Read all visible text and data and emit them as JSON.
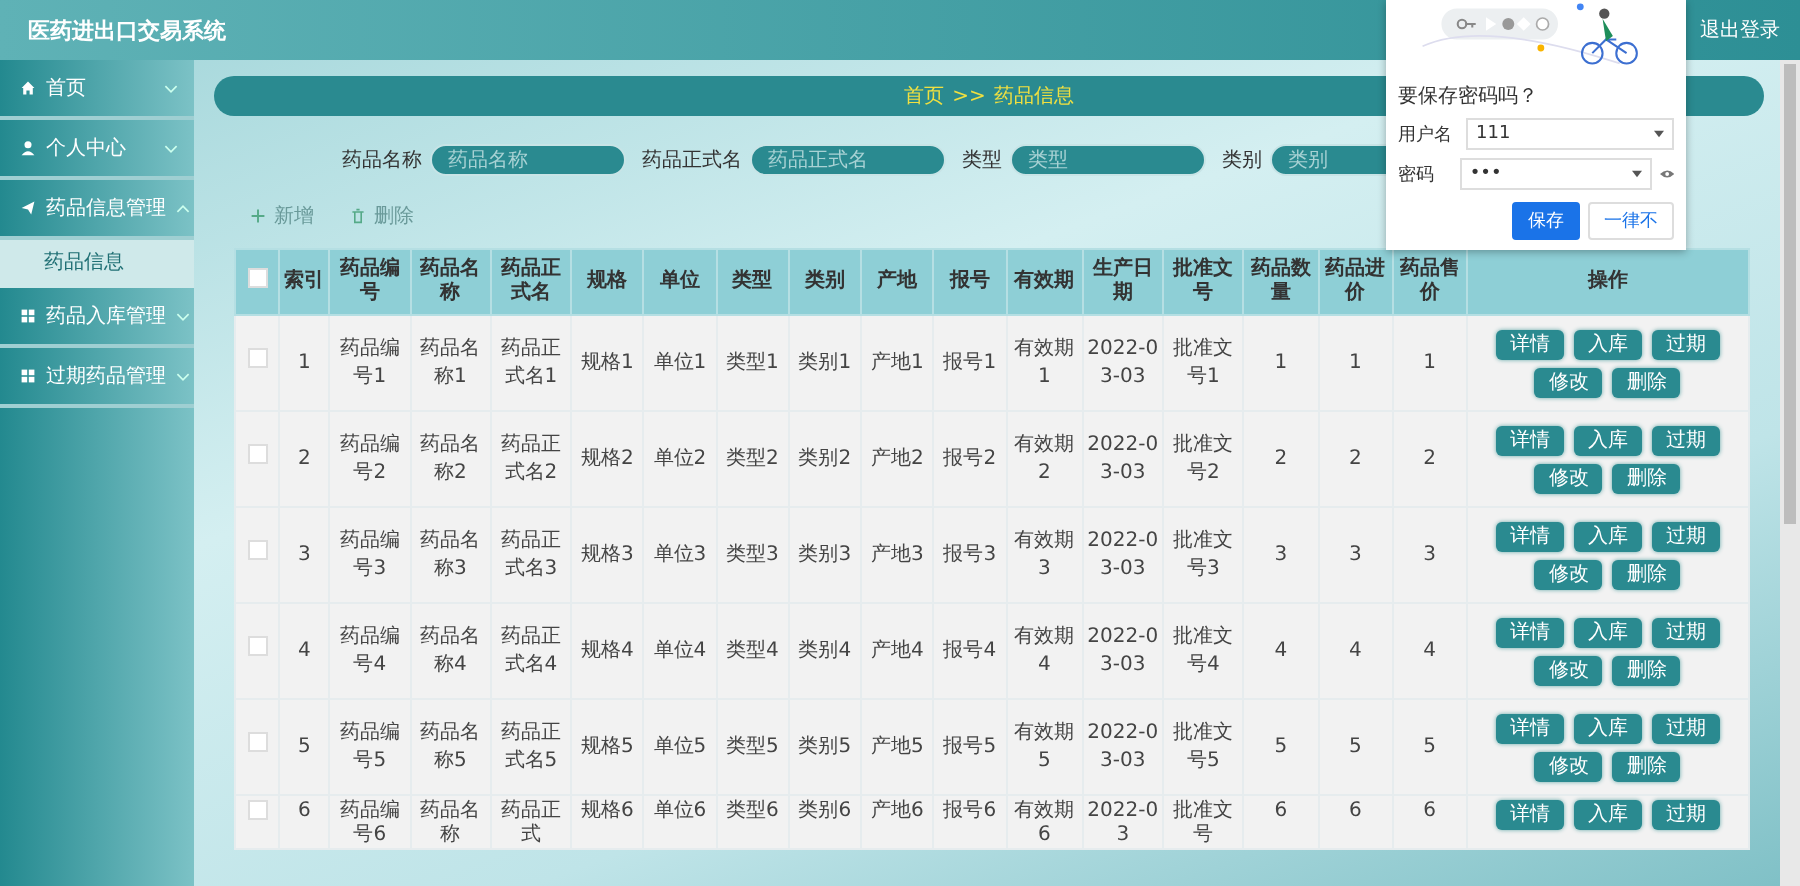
{
  "header": {
    "title": "医药进出口交易系统",
    "logout": "退出登录"
  },
  "sidebar": {
    "items": [
      {
        "label": "首页",
        "expanded": false
      },
      {
        "label": "个人中心",
        "expanded": false
      },
      {
        "label": "药品信息管理",
        "expanded": true,
        "children": [
          {
            "label": "药品信息",
            "selected": true
          }
        ]
      },
      {
        "label": "药品入库管理",
        "expanded": false
      },
      {
        "label": "过期药品管理",
        "expanded": false
      }
    ]
  },
  "breadcrumb": [
    "首页",
    ">>",
    "药品信息"
  ],
  "search": [
    {
      "label": "药品名称",
      "placeholder": "药品名称"
    },
    {
      "label": "药品正式名",
      "placeholder": "药品正式名"
    },
    {
      "label": "类型",
      "placeholder": "类型"
    },
    {
      "label": "类别",
      "placeholder": "类别"
    }
  ],
  "toolbar": [
    {
      "kind": "add",
      "label": "新增"
    },
    {
      "kind": "delete",
      "label": "删除"
    }
  ],
  "table": {
    "header_checked": false,
    "columns": [
      "索引",
      "药品编号",
      "药品名称",
      "药品正式名",
      "规格",
      "单位",
      "类型",
      "类别",
      "产地",
      "报号",
      "有效期",
      "生产日期",
      "批准文号",
      "药品数量",
      "药品进价",
      "药品售价",
      "操作"
    ],
    "rows": [
      {
        "checked": false,
        "cells": [
          "1",
          "药品编号1",
          "药品名称1",
          "药品正式名1",
          "规格1",
          "单位1",
          "类型1",
          "类别1",
          "产地1",
          "报号1",
          "有效期1",
          "2022-03-03",
          "批准文号1",
          "1",
          "1",
          "1"
        ],
        "actions": [
          "详情",
          "入库",
          "过期",
          "修改",
          "删除"
        ]
      },
      {
        "checked": false,
        "cells": [
          "2",
          "药品编号2",
          "药品名称2",
          "药品正式名2",
          "规格2",
          "单位2",
          "类型2",
          "类别2",
          "产地2",
          "报号2",
          "有效期2",
          "2022-03-03",
          "批准文号2",
          "2",
          "2",
          "2"
        ],
        "actions": [
          "详情",
          "入库",
          "过期",
          "修改",
          "删除"
        ]
      },
      {
        "checked": false,
        "cells": [
          "3",
          "药品编号3",
          "药品名称3",
          "药品正式名3",
          "规格3",
          "单位3",
          "类型3",
          "类别3",
          "产地3",
          "报号3",
          "有效期3",
          "2022-03-03",
          "批准文号3",
          "3",
          "3",
          "3"
        ],
        "actions": [
          "详情",
          "入库",
          "过期",
          "修改",
          "删除"
        ]
      },
      {
        "checked": false,
        "cells": [
          "4",
          "药品编号4",
          "药品名称4",
          "药品正式名4",
          "规格4",
          "单位4",
          "类型4",
          "类别4",
          "产地4",
          "报号4",
          "有效期4",
          "2022-03-03",
          "批准文号4",
          "4",
          "4",
          "4"
        ],
        "actions": [
          "详情",
          "入库",
          "过期",
          "修改",
          "删除"
        ]
      },
      {
        "checked": false,
        "cells": [
          "5",
          "药品编号5",
          "药品名称5",
          "药品正式名5",
          "规格5",
          "单位5",
          "类型5",
          "类别5",
          "产地5",
          "报号5",
          "有效期5",
          "2022-03-03",
          "批准文号5",
          "5",
          "5",
          "5"
        ],
        "actions": [
          "详情",
          "入库",
          "过期",
          "修改",
          "删除"
        ]
      },
      {
        "checked": false,
        "cells": [
          "6",
          "药品编号6",
          "药品名称",
          "药品正式",
          "规格6",
          "单位6",
          "类型6",
          "类别6",
          "产地6",
          "报号6",
          "有效期6",
          "2022-03",
          "批准文号",
          "6",
          "6",
          "6"
        ],
        "actions": [
          "详情",
          "入库",
          "过期"
        ]
      }
    ]
  },
  "password_popup": {
    "title": "要保存密码吗？",
    "fields": [
      {
        "label": "用户名",
        "value": "111",
        "secret": false
      },
      {
        "label": "密码",
        "value": "•••",
        "secret": true
      }
    ],
    "buttons": [
      {
        "label": "保存",
        "primary": true
      },
      {
        "label": "一律不",
        "primary": false
      }
    ]
  }
}
